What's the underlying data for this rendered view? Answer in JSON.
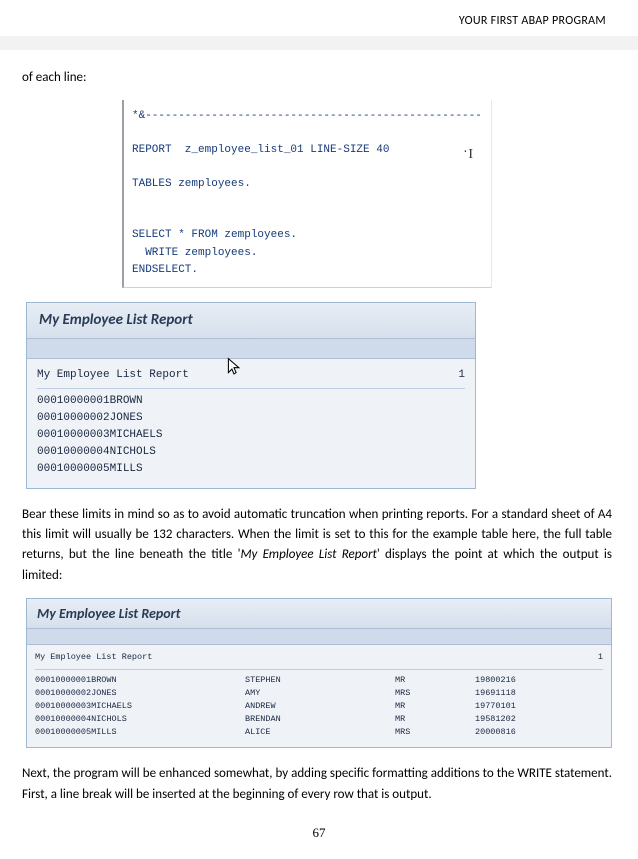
{
  "header": {
    "section": "YOUR FIRST ABAP PROGRAM"
  },
  "frag_top": "of each line:",
  "code1": {
    "line1": "*&---------------------------------------------------",
    "line2": "REPORT  z_employee_list_01 LINE-SIZE 40",
    "dot": ".",
    "line3": "TABLES zemployees.",
    "line4": "SELECT * FROM zemployees.",
    "line5": "  WRITE zemployees.",
    "line6": "ENDSELECT."
  },
  "panel1": {
    "title": "My Employee List Report",
    "head_label": "My Employee List Report",
    "head_num": "1",
    "rows": [
      "00010000001BROWN",
      "00010000002JONES",
      "00010000003MICHAELS",
      "00010000004NICHOLS",
      "00010000005MILLS"
    ]
  },
  "para1_a": "Bear these limits in mind so as to avoid automatic truncation when printing reports. For a standard sheet of A4 this limit will usually be 132 characters. When the limit is set to this for the example table here, the full table returns, but the line beneath the title '",
  "para1_em": "My Employee List Report",
  "para1_b": "' displays the point at which the output is limited:",
  "panel2": {
    "title": "My Employee List Report",
    "head_label": "My Employee List Report",
    "head_num": "1",
    "rows": [
      {
        "c1": "00010000001BROWN",
        "c2": "STEPHEN",
        "c3": "MR",
        "c4": "19800216"
      },
      {
        "c1": "00010000002JONES",
        "c2": "AMY",
        "c3": "MRS",
        "c4": "19691118"
      },
      {
        "c1": "00010000003MICHAELS",
        "c2": "ANDREW",
        "c3": "MR",
        "c4": "19770101"
      },
      {
        "c1": "00010000004NICHOLS",
        "c2": "BRENDAN",
        "c3": "MR",
        "c4": "19581202"
      },
      {
        "c1": "00010000005MILLS",
        "c2": "ALICE",
        "c3": "MRS",
        "c4": "20000816"
      }
    ]
  },
  "para2": "Next, the program will be enhanced somewhat, by adding specific formatting additions to the WRITE statement. First, a line break will be inserted at the beginning of every row that is output.",
  "footer": {
    "page": "67"
  }
}
